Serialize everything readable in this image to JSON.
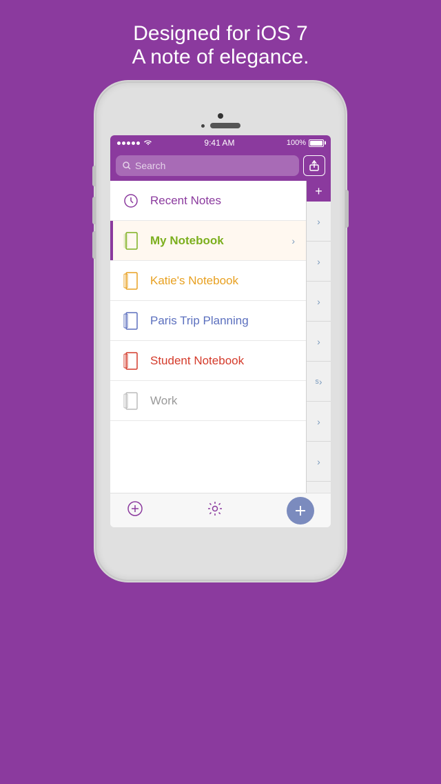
{
  "tagline": {
    "line1": "Designed for iOS 7",
    "line2": "A note of elegance."
  },
  "status_bar": {
    "time": "9:41 AM",
    "battery_pct": "100%"
  },
  "search": {
    "placeholder": "Search"
  },
  "share_button_label": "↑",
  "add_button_label": "+",
  "notebooks": [
    {
      "id": "recent",
      "label": "Recent Notes",
      "color_class": "recent-notes-color",
      "icon_type": "clock",
      "selected": false
    },
    {
      "id": "my-notebook",
      "label": "My Notebook",
      "color_class": "my-notebook-color",
      "icon_type": "notebook-green",
      "selected": true
    },
    {
      "id": "katies",
      "label": "Katie's Notebook",
      "color_class": "katies-color",
      "icon_type": "notebook-orange",
      "selected": false
    },
    {
      "id": "paris",
      "label": "Paris Trip Planning",
      "color_class": "paris-color",
      "icon_type": "notebook-blue",
      "selected": false
    },
    {
      "id": "student",
      "label": "Student Notebook",
      "color_class": "student-color",
      "icon_type": "notebook-red",
      "selected": false
    },
    {
      "id": "work",
      "label": "Work",
      "color_class": "work-color",
      "icon_type": "notebook-gray",
      "selected": false
    }
  ],
  "side_panel": {
    "items": [
      "",
      "",
      "",
      "",
      "s",
      "",
      ""
    ]
  },
  "toolbar": {
    "add_note_label": "⊕",
    "settings_label": "⚙",
    "fab_label": "+"
  }
}
